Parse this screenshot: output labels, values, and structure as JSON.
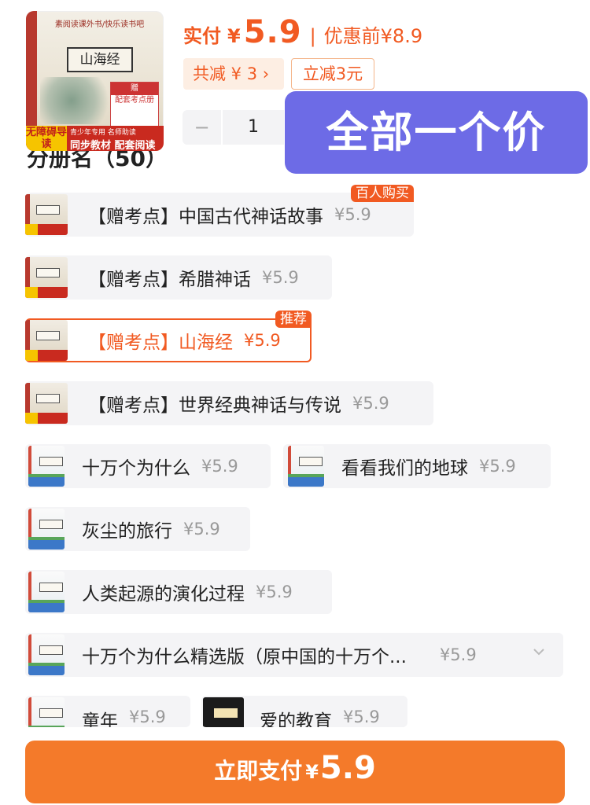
{
  "product": {
    "cover": {
      "series": "素阅读课外书/快乐读书吧",
      "title": "山海经",
      "gift_head": "赠",
      "gift_text": "配套考点册",
      "stripe_top": "无障碍导读",
      "stripe_mid": "青少年专用 名师助读",
      "stripe_main": "同步教材 配套阅读"
    },
    "price_label": "实付",
    "currency": "¥",
    "price": "5.9",
    "separator": "|",
    "original_label": "优惠前",
    "original_price": "¥8.9",
    "reduce_tag": "共减 ¥ 3 ›",
    "direct_tag": "立减3元",
    "quantity": {
      "minus": "−",
      "value": "1",
      "plus": "+"
    },
    "overlay_text": "全部一个价"
  },
  "section_title": "分册名（50）",
  "options": [
    {
      "label": "【赠考点】中国古代神话故事",
      "price": "¥5.9",
      "badge": "百人购买"
    },
    {
      "label": "【赠考点】希腊神话",
      "price": "¥5.9"
    },
    {
      "label": "【赠考点】山海经",
      "price": "¥5.9",
      "badge": "推荐",
      "selected": true
    },
    {
      "label": "【赠考点】世界经典神话与传说",
      "price": "¥5.9"
    },
    {
      "label": "十万个为什么",
      "price": "¥5.9"
    },
    {
      "label": "看看我们的地球",
      "price": "¥5.9"
    },
    {
      "label": "灰尘的旅行",
      "price": "¥5.9"
    },
    {
      "label": "人类起源的演化过程",
      "price": "¥5.9"
    },
    {
      "label": "十万个为什么精选版（原中国的十万个...",
      "price": "¥5.9",
      "chevron": "chevron-down-icon"
    },
    {
      "label": "童年",
      "price": "¥5.9"
    },
    {
      "label": "爱的教育",
      "price": "¥5.9"
    }
  ],
  "pay_button": {
    "label": "立即支付",
    "currency": "¥",
    "amount": "5.9"
  },
  "colors": {
    "accent": "#f15a22",
    "pay_button": "#f47a2a",
    "overlay": "#6d6be6",
    "chip_bg": "#f4f4f6"
  }
}
